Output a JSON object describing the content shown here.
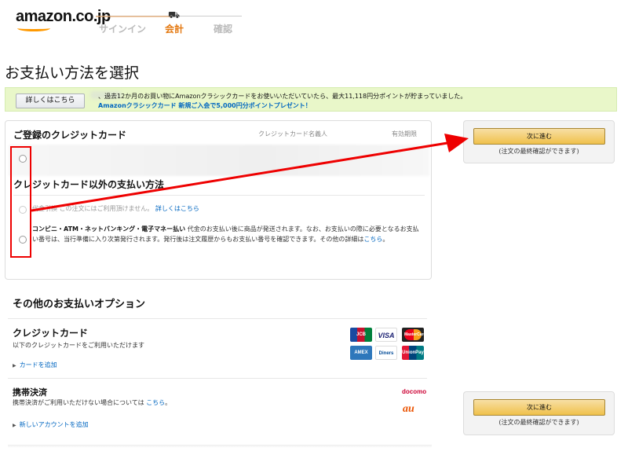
{
  "header": {
    "logo": "amazon.co.jp",
    "steps": [
      "サインイン",
      "会計",
      "確認"
    ]
  },
  "page_title": "お支払い方法を選択",
  "promo": {
    "detail_button": "詳しくはこちら",
    "line1": "、過去12か月のお買い物にAmazonクラシックカードをお使いいただいていたら、最大11,118円分ポイントが貯まっていました。",
    "line2": "Amazonクラシックカード 新規ご入会で5,000円分ポイントプレゼント！"
  },
  "main": {
    "cc_heading": "ご登録のクレジットカード",
    "col_name": "クレジットカード名義人",
    "col_expiry": "有効期限",
    "other_heading": "クレジットカード以外の支払い方法",
    "cod_text": "代金引換 この注文にはご利用頂けません。",
    "cod_link": "詳しくはこちら",
    "conv_bold": "コンビニ・ATM・ネットバンキング・電子マネー払い",
    "conv_text": " 代金のお支払い後に商品が発送されます。なお、お支払いの際に必要となるお支払い番号は、当行準備に入り次第発行されます。発行後は注文履歴からもお支払い番号を確認できます。その他の詳細は",
    "conv_link": "こちら",
    "conv_end": "。"
  },
  "continue": {
    "button": "次に進む",
    "note": "(注文の最終確認ができます)"
  },
  "options": {
    "heading": "その他のお支払いオプション",
    "cc_title": "クレジットカード",
    "cc_desc": "以下のクレジットカードをご利用いただけます",
    "cc_add": "カードを追加",
    "mobile_title": "携帯決済",
    "mobile_desc": "携帯決済がご利用いただけない場合については",
    "mobile_link": "こちら",
    "mobile_end": "。",
    "mobile_add": "新しいアカウントを追加",
    "cards": [
      "JCB",
      "VISA",
      "MasterCard",
      "AMEX",
      "Diners",
      "UnionPay"
    ],
    "carriers": [
      "docomo",
      "au"
    ]
  },
  "colors": {
    "accent": "#e47911",
    "link": "#0066c0",
    "button": "#f0c14b",
    "annotation": "#e00000"
  }
}
